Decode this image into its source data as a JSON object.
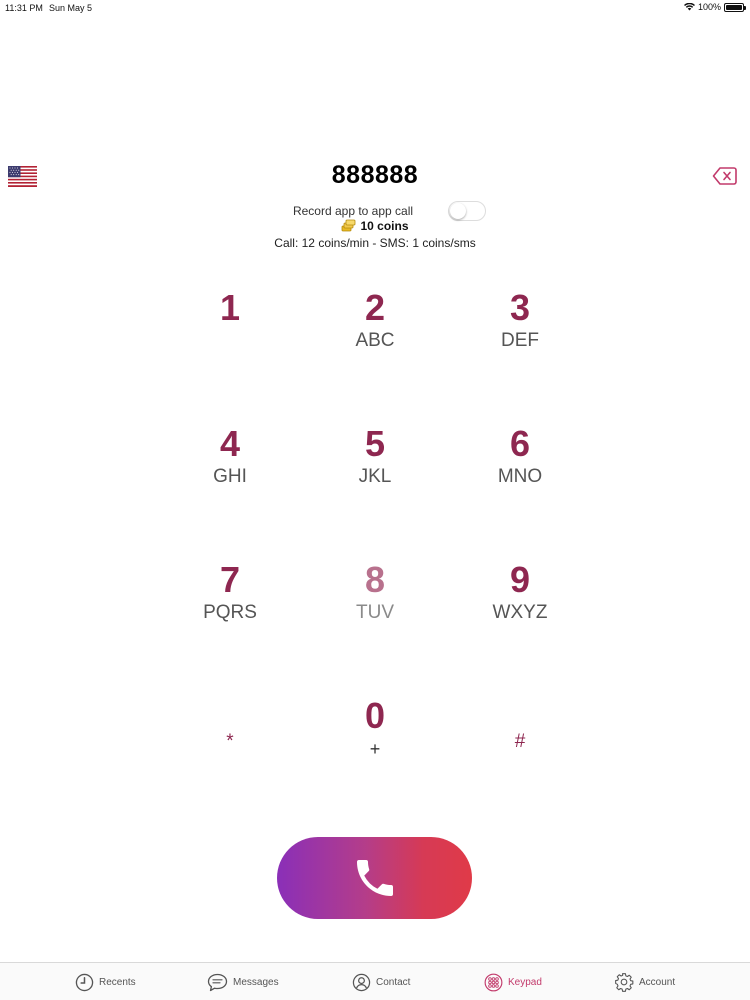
{
  "status_bar": {
    "time": "11:31 PM",
    "date": "Sun May 5",
    "battery": "100%"
  },
  "dialer": {
    "number": "888888",
    "record_label": "Record app to app call",
    "record_enabled": false,
    "coins": "10 coins",
    "rates": "Call: 12 coins/min - SMS: 1 coins/sms"
  },
  "keypad": {
    "keys": [
      {
        "digit": "1",
        "letters": ""
      },
      {
        "digit": "2",
        "letters": "ABC"
      },
      {
        "digit": "3",
        "letters": "DEF"
      },
      {
        "digit": "4",
        "letters": "GHI"
      },
      {
        "digit": "5",
        "letters": "JKL"
      },
      {
        "digit": "6",
        "letters": "MNO"
      },
      {
        "digit": "7",
        "letters": "PQRS"
      },
      {
        "digit": "8",
        "letters": "TUV"
      },
      {
        "digit": "9",
        "letters": "WXYZ"
      },
      {
        "digit": "*",
        "letters": ""
      },
      {
        "digit": "0",
        "letters": "+"
      },
      {
        "digit": "#",
        "letters": ""
      }
    ]
  },
  "tabs": [
    {
      "label": "Recents",
      "icon": "clock-icon"
    },
    {
      "label": "Messages",
      "icon": "chat-bubble-icon"
    },
    {
      "label": "Contact",
      "icon": "person-icon"
    },
    {
      "label": "Keypad",
      "icon": "keypad-grid-icon",
      "active": true
    },
    {
      "label": "Account",
      "icon": "gear-icon"
    }
  ],
  "colors": {
    "accent": "#8e2750",
    "tab_active": "#c23a6b",
    "call_gradient_start": "#8a2fb8",
    "call_gradient_end": "#e03a48"
  }
}
